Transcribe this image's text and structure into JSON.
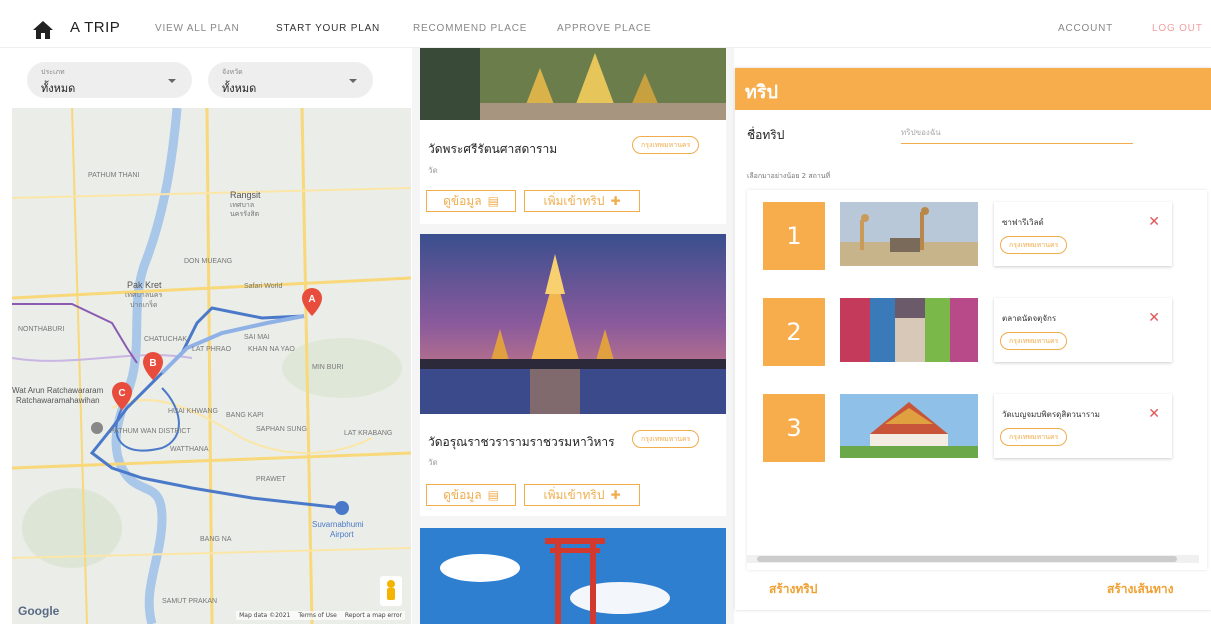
{
  "nav": {
    "brand": "A TRIP",
    "links": [
      "VIEW ALL PLAN",
      "START YOUR PLAN",
      "RECOMMEND PLACE",
      "APPROVE PLACE"
    ],
    "account": "ACCOUNT",
    "logout": "LOG OUT"
  },
  "filters": [
    {
      "label": "ประเภท",
      "value": "ทั้งหมด"
    },
    {
      "label": "จังหวัด",
      "value": "ทั้งหมด"
    }
  ],
  "map": {
    "labels": [
      "Pak Kret",
      "เทศบาลนคร",
      "ปากเกร็ด",
      "Rangsit",
      "เทศบาล",
      "นครรังสิต",
      "Safari World",
      "DON MUEANG",
      "CHATUCHAK",
      "LAT PHRAO",
      "KHAN NA YAO",
      "MIN BURI",
      "Wat Arun Ratchawararam",
      "Ratchawaramahawihan",
      "HUAI KHWANG",
      "BANG KAPI",
      "PATHUM WAN DISTRICT",
      "WATTHANA",
      "SAPHAN SUNG",
      "PRAWET",
      "Suvarnabhumi",
      "Airport",
      "BANG NA",
      "SAMUT PRAKAN",
      "NONTHABURI",
      "PATHUM THANI",
      "SAI MAI",
      "LAT KRABANG"
    ],
    "pins": [
      "A",
      "B",
      "C"
    ],
    "google": "Google",
    "footer": [
      "Map data ©2021",
      "Terms of Use",
      "Report a map error"
    ]
  },
  "places": [
    {
      "name": "วัดพระศรีรัตนศาสดาราม",
      "type": "วัด",
      "province": "กรุงเทพมหานคร"
    },
    {
      "name": "วัดอรุณราชวรารามราชวรมหาวิหาร",
      "type": "วัด",
      "province": "กรุงเทพมหานคร"
    }
  ],
  "place_buttons": {
    "info": "ดูข้อมูล",
    "add": "เพิ่มเข้าทริป"
  },
  "trip": {
    "title": "ทริป",
    "name_label": "ชื่อทริป",
    "name_placeholder": "ทริปของฉัน",
    "hint": "เลือกมาอย่างน้อย 2 สถานที่",
    "items": [
      {
        "num": "1",
        "name": "ซาฟารีเวิลด์",
        "province": "กรุงเทพมหานคร"
      },
      {
        "num": "2",
        "name": "ตลาดนัดจตุจักร",
        "province": "กรุงเทพมหานคร"
      },
      {
        "num": "3",
        "name": "วัดเบญจมบพิตรดุสิตวนาราม",
        "province": "กรุงเทพมหานคร"
      }
    ],
    "create_trip": "สร้างทริป",
    "create_route": "สร้างเส้นทาง"
  },
  "colors": {
    "accent": "#f7ad4c",
    "remove": "#e05555"
  }
}
